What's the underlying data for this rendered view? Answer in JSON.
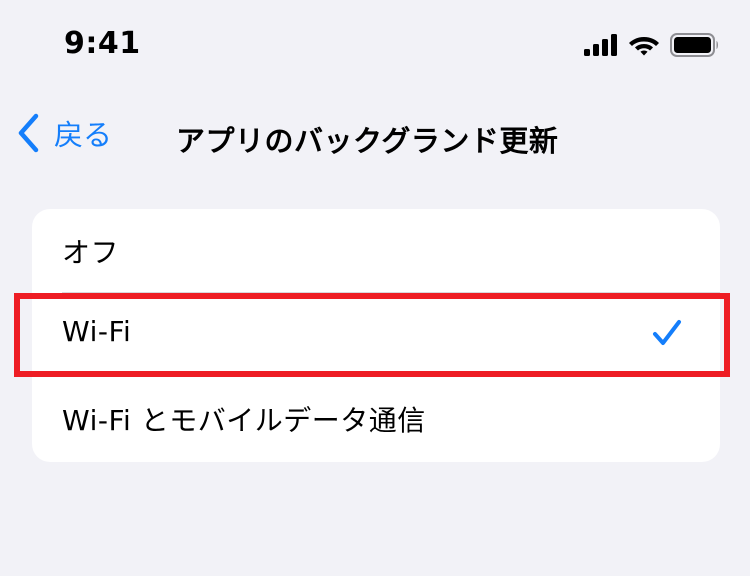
{
  "status_bar": {
    "time": "9:41",
    "icons": [
      "cellular-signal-icon",
      "wifi-icon",
      "battery-icon"
    ]
  },
  "nav": {
    "back_label": "戻る",
    "back_icon": "chevron-left-icon",
    "title": "アプリのバックグランド更新"
  },
  "options": [
    {
      "label": "オフ",
      "selected": false
    },
    {
      "label": "Wi-Fi",
      "selected": true
    },
    {
      "label": "Wi-Fi とモバイルデータ通信",
      "selected": false
    }
  ],
  "colors": {
    "accent": "#147efb",
    "background": "#f2f2f7",
    "highlight": "#ee1d24"
  }
}
